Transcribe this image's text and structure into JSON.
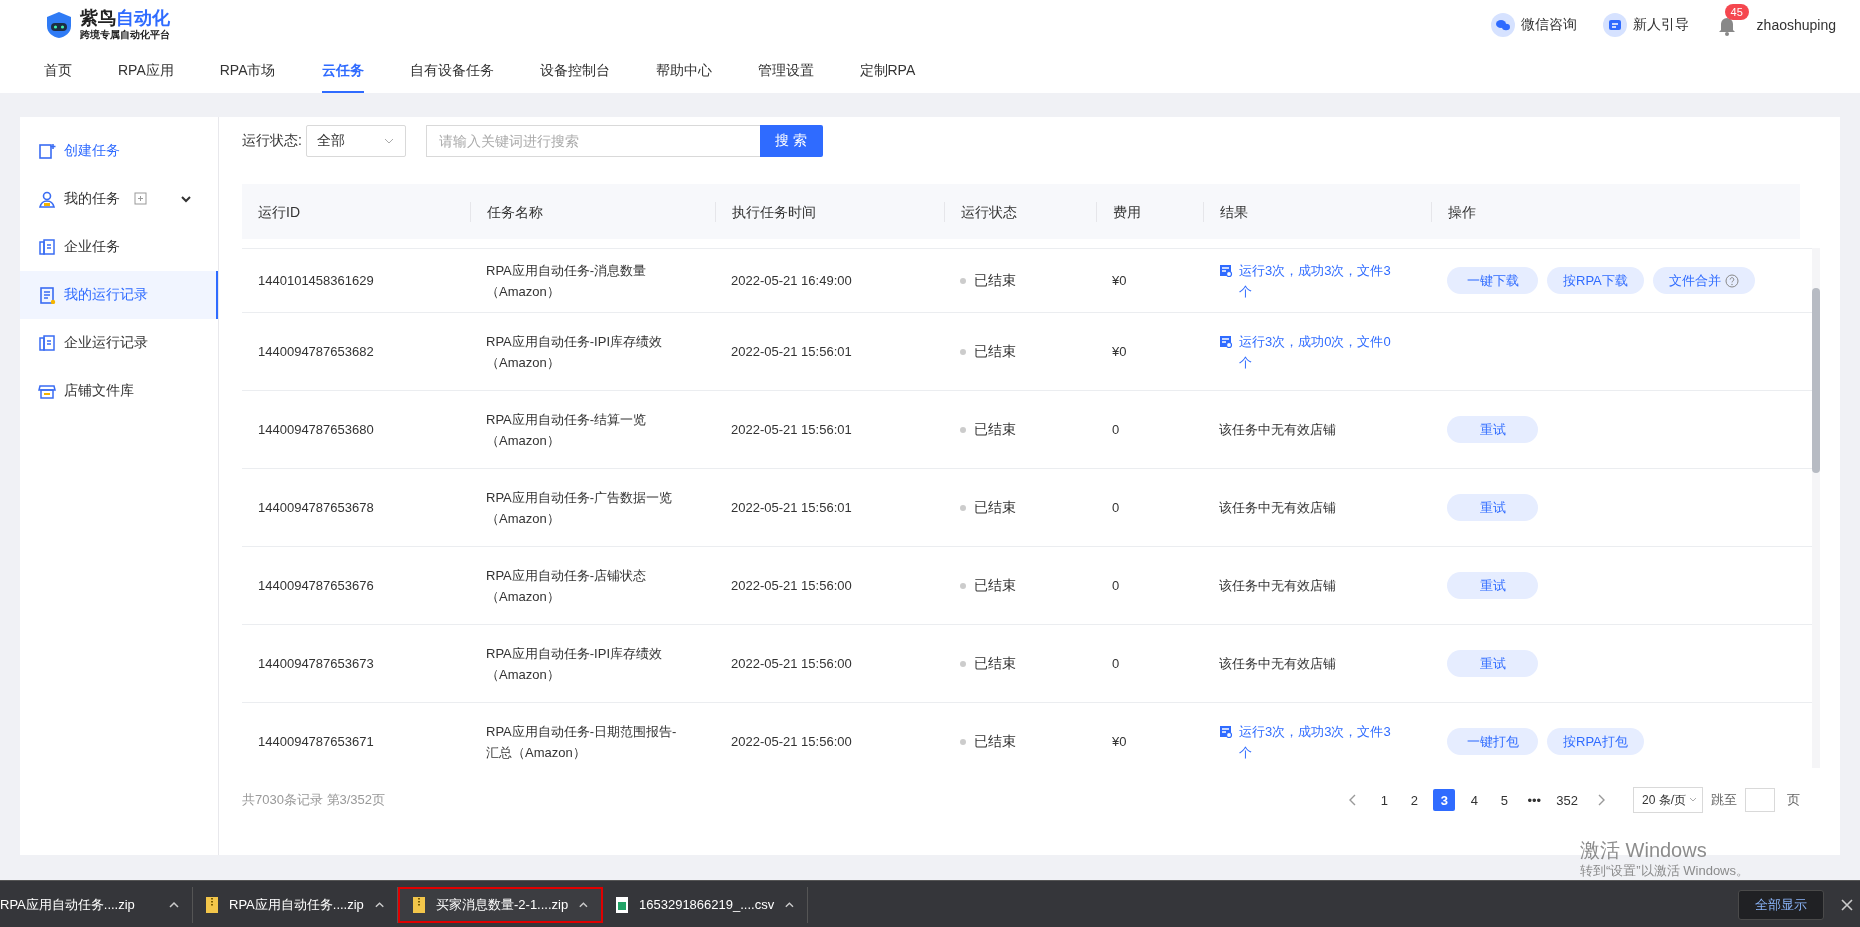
{
  "logo": {
    "title": "紫鸟",
    "title_accent": "自动化",
    "subtitle": "跨境专属自动化平台"
  },
  "header_actions": [
    {
      "label": "微信咨询",
      "kind": "wechat"
    },
    {
      "label": "新人引导",
      "kind": "guide"
    }
  ],
  "notifications": {
    "count": "45"
  },
  "user": {
    "name": "zhaoshuping"
  },
  "nav": [
    {
      "label": "首页",
      "selected": false
    },
    {
      "label": "RPA应用",
      "selected": false
    },
    {
      "label": "RPA市场",
      "selected": false
    },
    {
      "label": "云任务",
      "selected": true
    },
    {
      "label": "自有设备任务",
      "selected": false
    },
    {
      "label": "设备控制台",
      "selected": false
    },
    {
      "label": "帮助中心",
      "selected": false
    },
    {
      "label": "管理设置",
      "selected": false
    },
    {
      "label": "定制RPA",
      "selected": false
    }
  ],
  "sidebar": {
    "items": [
      {
        "label": "创建任务",
        "selected": false,
        "kind": "create"
      },
      {
        "label": "我的任务",
        "selected": false,
        "kind": "group",
        "expanded": true
      },
      {
        "label": "企业任务",
        "selected": false,
        "kind": "doc"
      },
      {
        "label": "我的运行记录",
        "selected": true,
        "kind": "record"
      },
      {
        "label": "企业运行记录",
        "selected": false,
        "kind": "doc"
      },
      {
        "label": "店铺文件库",
        "selected": false,
        "kind": "store"
      }
    ]
  },
  "filter": {
    "label": "运行状态:",
    "status_value": "全部",
    "search_placeholder": "请输入关键词进行搜索",
    "search_button": "搜 索"
  },
  "table": {
    "columns": [
      "运行ID",
      "任务名称",
      "执行任务时间",
      "运行状态",
      "费用",
      "结果",
      "操作"
    ],
    "rows": [
      {
        "id": "1440101458361629",
        "name_lines": [
          "RPA应用自动任务-消息数量",
          "（Amazon）"
        ],
        "time": "2022-05-21 16:49:00",
        "status": "已结束",
        "fee": "¥0",
        "result": {
          "kind": "link",
          "text": "运行3次，成功3次，文件3个"
        },
        "actions": [
          {
            "label": "一键下载",
            "help": false
          },
          {
            "label": "按RPA下载",
            "help": false
          },
          {
            "label": "文件合并",
            "help": true
          }
        ]
      },
      {
        "id": "1440094787653682",
        "name_lines": [
          "RPA应用自动任务-IPI库存绩效",
          "（Amazon）"
        ],
        "time": "2022-05-21 15:56:01",
        "status": "已结束",
        "fee": "¥0",
        "result": {
          "kind": "link",
          "text": "运行3次，成功0次，文件0个"
        },
        "actions": []
      },
      {
        "id": "1440094787653680",
        "name_lines": [
          "RPA应用自动任务-结算一览",
          "（Amazon）"
        ],
        "time": "2022-05-21 15:56:01",
        "status": "已结束",
        "fee": "0",
        "result": {
          "kind": "plain",
          "text": "该任务中无有效店铺"
        },
        "actions": [
          {
            "label": "重试",
            "help": false
          }
        ]
      },
      {
        "id": "1440094787653678",
        "name_lines": [
          "RPA应用自动任务-广告数据一览",
          "（Amazon）"
        ],
        "time": "2022-05-21 15:56:01",
        "status": "已结束",
        "fee": "0",
        "result": {
          "kind": "plain",
          "text": "该任务中无有效店铺"
        },
        "actions": [
          {
            "label": "重试",
            "help": false
          }
        ]
      },
      {
        "id": "1440094787653676",
        "name_lines": [
          "RPA应用自动任务-店铺状态",
          "（Amazon）"
        ],
        "time": "2022-05-21 15:56:00",
        "status": "已结束",
        "fee": "0",
        "result": {
          "kind": "plain",
          "text": "该任务中无有效店铺"
        },
        "actions": [
          {
            "label": "重试",
            "help": false
          }
        ]
      },
      {
        "id": "1440094787653673",
        "name_lines": [
          "RPA应用自动任务-IPI库存绩效",
          "（Amazon）"
        ],
        "time": "2022-05-21 15:56:00",
        "status": "已结束",
        "fee": "0",
        "result": {
          "kind": "plain",
          "text": "该任务中无有效店铺"
        },
        "actions": [
          {
            "label": "重试",
            "help": false
          }
        ]
      },
      {
        "id": "1440094787653671",
        "name_lines": [
          "RPA应用自动任务-日期范围报告-",
          "汇总（Amazon）"
        ],
        "time": "2022-05-21 15:56:00",
        "status": "已结束",
        "fee": "¥0",
        "result": {
          "kind": "link",
          "text": "运行3次，成功3次，文件3个"
        },
        "actions": [
          {
            "label": "一键打包",
            "help": false
          },
          {
            "label": "按RPA打包",
            "help": false
          }
        ]
      }
    ]
  },
  "pagination": {
    "summary": "共7030条记录 第3/352页",
    "pages": [
      {
        "label": "1",
        "selected": false
      },
      {
        "label": "2",
        "selected": false
      },
      {
        "label": "3",
        "selected": true
      },
      {
        "label": "4",
        "selected": false
      },
      {
        "label": "5",
        "selected": false
      },
      {
        "label": "•••",
        "selected": false
      },
      {
        "label": "352",
        "selected": false
      }
    ],
    "page_size": "20 条/页",
    "jump_label": "跳至",
    "jump_suffix": "页"
  },
  "os_notice": {
    "title": "激活 Windows",
    "subtitle": "转到“设置”以激活 Windows。"
  },
  "downloads": {
    "items": [
      {
        "filename": "RPA应用自动任务....zip",
        "highlighted": false
      },
      {
        "filename": "RPA应用自动任务....zip",
        "kind": "zip",
        "highlighted": false
      },
      {
        "filename": "买家消息数量-2-1....zip",
        "kind": "zip",
        "highlighted": true
      },
      {
        "filename": "1653291866219_....csv",
        "kind": "csv",
        "highlighted": false
      }
    ],
    "show_all": "全部显示"
  }
}
